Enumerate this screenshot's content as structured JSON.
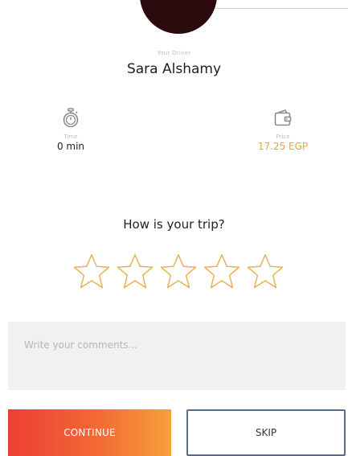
{
  "driver": {
    "caption": "Your Driver",
    "name": "Sara Alshamy"
  },
  "trip_info": {
    "time": {
      "icon": "stopwatch-icon",
      "caption": "Time",
      "value": "0 min"
    },
    "price": {
      "icon": "wallet-icon",
      "caption": "Price",
      "value": "17.25 EGP"
    }
  },
  "rating": {
    "question": "How is your trip?",
    "star_count": 5,
    "selected": 0
  },
  "comments": {
    "placeholder": "Write your comments..."
  },
  "actions": {
    "continue_label": "CONTINUE",
    "skip_label": "SKIP"
  },
  "colors": {
    "accent": "#f0a23a",
    "star_outline": "#e8b25a",
    "gradient_start": "#ee3d33",
    "gradient_end": "#f6a03c",
    "skip_border": "#5c6b86"
  }
}
